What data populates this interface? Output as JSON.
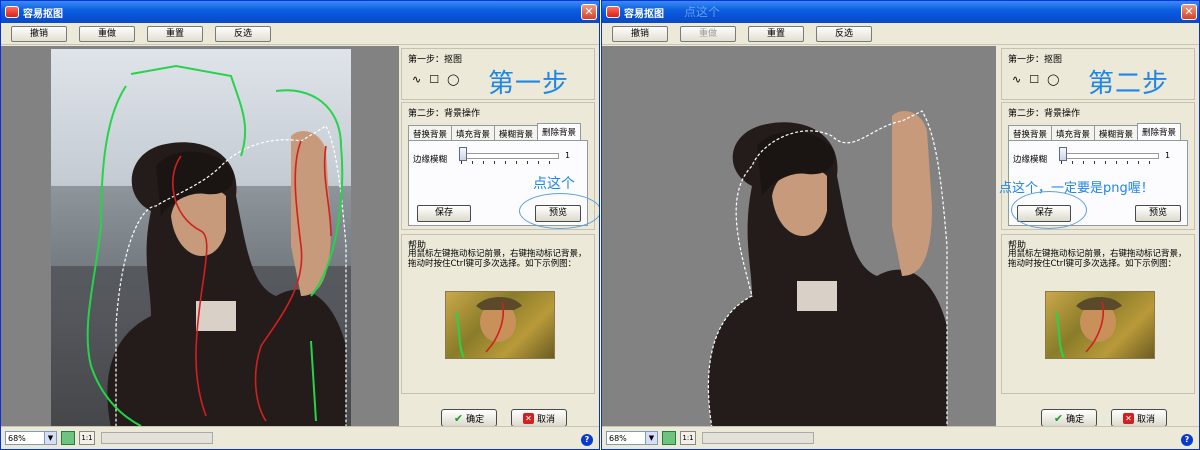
{
  "windows": [
    {
      "title": "容易抠图",
      "toolbar": {
        "undo": "撤销",
        "redo": "重做",
        "reset": "重置",
        "invert": "反选"
      },
      "step1": {
        "label": "第一步：抠图",
        "annotation": "第一步"
      },
      "step2": {
        "label": "第二步：背景操作",
        "tabs": [
          "替换背景",
          "填充背景",
          "模糊背景",
          "删除背景"
        ],
        "active_tab": "删除背景",
        "slider_label": "边缘模糊",
        "slider_value": "1",
        "save_label": "保存",
        "preview_label": "预览",
        "annotation": "点这个"
      },
      "help": {
        "label": "帮助",
        "text": "用鼠标左键拖动标记前景，右键拖动标记背景，拖动时按住Ctrl键可多次选择。如下示例图："
      },
      "ok_label": "确定",
      "cancel_label": "取消",
      "status": {
        "zoom": "68%",
        "actual_size": "1:1"
      }
    },
    {
      "title": "容易抠图",
      "title_annotation": "点这个",
      "toolbar": {
        "undo": "撤销",
        "redo": "重做",
        "reset": "重置",
        "invert": "反选"
      },
      "step1": {
        "label": "第一步：抠图",
        "annotation": "第二步"
      },
      "step2": {
        "label": "第二步：背景操作",
        "tabs": [
          "替换背景",
          "填充背景",
          "模糊背景",
          "删除背景"
        ],
        "active_tab": "删除背景",
        "slider_label": "边缘模糊",
        "slider_value": "1",
        "save_label": "保存",
        "preview_label": "预览",
        "annotation": "点这个，一定要是png喔！"
      },
      "help": {
        "label": "帮助",
        "text": "用鼠标左键拖动标记前景，右键拖动标记背景，拖动时按住Ctrl键可多次选择。如下示例图："
      },
      "ok_label": "确定",
      "cancel_label": "取消",
      "status": {
        "zoom": "68%",
        "actual_size": "1:1"
      }
    }
  ],
  "colors": {
    "annotation": "#1e86e6",
    "titlebar": "#0c5fe0",
    "dialog_bg": "#ece9d8",
    "canvas_bg": "#828282"
  }
}
